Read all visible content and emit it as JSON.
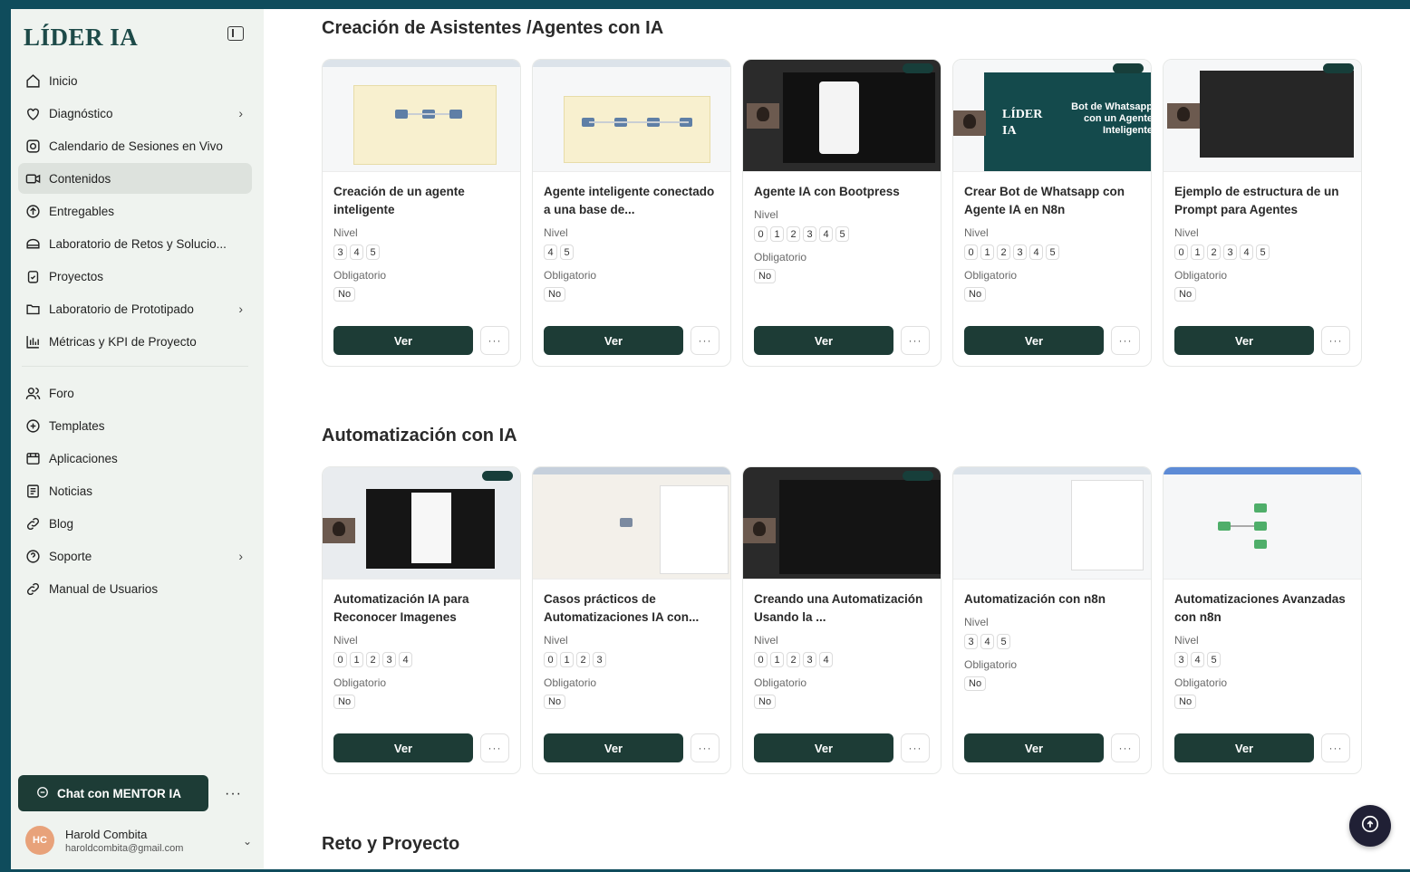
{
  "sidebar": {
    "brand": "LÍDER IA",
    "items": [
      {
        "label": "Inicio"
      },
      {
        "label": "Diagnóstico"
      },
      {
        "label": "Calendario de Sesiones en Vivo"
      },
      {
        "label": "Contenidos"
      },
      {
        "label": "Entregables"
      },
      {
        "label": "Laboratorio de Retos y Solucio..."
      },
      {
        "label": "Proyectos"
      },
      {
        "label": "Laboratorio de Prototipado"
      },
      {
        "label": "Métricas y KPI de Proyecto"
      }
    ],
    "items2": [
      {
        "label": "Foro"
      },
      {
        "label": "Templates"
      },
      {
        "label": "Aplicaciones"
      },
      {
        "label": "Noticias"
      },
      {
        "label": "Blog"
      },
      {
        "label": "Soporte"
      },
      {
        "label": "Manual de Usuarios"
      }
    ],
    "chat_label": "Chat con MENTOR IA",
    "more": "···",
    "user": {
      "initials": "HC",
      "name": "Harold Combita",
      "email": "haroldcombita@gmail.com"
    }
  },
  "labels": {
    "nivel": "Nivel",
    "obligatorio": "Obligatorio",
    "ver": "Ver",
    "more": "···"
  },
  "sections": [
    {
      "title": "Creación de Asistentes /Agentes con IA",
      "cards": [
        {
          "title": "Creación de un agente inteligente",
          "levels": [
            "3",
            "4",
            "5"
          ],
          "required": "No"
        },
        {
          "title": "Agente inteligente conectado a una base de...",
          "levels": [
            "4",
            "5"
          ],
          "required": "No"
        },
        {
          "title": "Agente IA con Bootpress",
          "levels": [
            "0",
            "1",
            "2",
            "3",
            "4",
            "5"
          ],
          "required": "No"
        },
        {
          "title": "Crear Bot de Whatsapp con Agente IA en N8n",
          "levels": [
            "0",
            "1",
            "2",
            "3",
            "4",
            "5"
          ],
          "required": "No",
          "thumb_text": "Bot de Whatsapp con un Agente Inteligente",
          "thumb_logo": "LÍDER IA"
        },
        {
          "title": "Ejemplo de estructura de un Prompt para Agentes",
          "levels": [
            "0",
            "1",
            "2",
            "3",
            "4",
            "5"
          ],
          "required": "No"
        }
      ]
    },
    {
      "title": "Automatización con IA",
      "cards": [
        {
          "title": "Automatización IA para Reconocer Imagenes",
          "levels": [
            "0",
            "1",
            "2",
            "3",
            "4"
          ],
          "required": "No"
        },
        {
          "title": "Casos prácticos de Automatizaciones IA con...",
          "levels": [
            "0",
            "1",
            "2",
            "3"
          ],
          "required": "No"
        },
        {
          "title": "Creando una Automatización Usando la ...",
          "levels": [
            "0",
            "1",
            "2",
            "3",
            "4"
          ],
          "required": "No"
        },
        {
          "title": "Automatización con n8n",
          "levels": [
            "3",
            "4",
            "5"
          ],
          "required": "No"
        },
        {
          "title": "Automatizaciones Avanzadas con n8n",
          "levels": [
            "3",
            "4",
            "5"
          ],
          "required": "No"
        }
      ]
    },
    {
      "title": "Reto y Proyecto"
    }
  ],
  "colors": {
    "accent": "#1d3c36",
    "frame": "#0f4c5c",
    "sidebar_bg": "#eff3ef"
  },
  "icons": [
    "house-icon",
    "shield-heart-icon",
    "calendar-icon",
    "video-icon",
    "upload-icon",
    "lab-icon",
    "clipboard-icon",
    "folder-icon",
    "chart-icon",
    "users-icon",
    "templates-icon",
    "apps-icon",
    "news-icon",
    "link-icon",
    "help-icon",
    "link-icon",
    "chat-icon",
    "cloud-upload-icon"
  ]
}
